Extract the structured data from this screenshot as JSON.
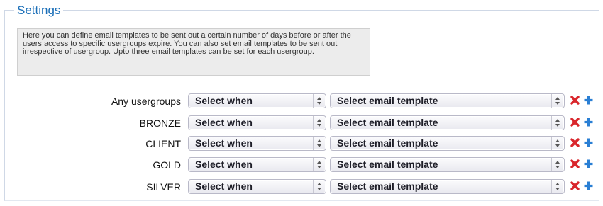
{
  "settings": {
    "legend": "Settings",
    "info_text": "Here you can define email templates to be sent out a certain number of days before or after the users access to specific usergroups expire. You can also set email templates to be sent out irrespective of usergroup. Upto three email templates can be set for each usergroup."
  },
  "rows": [
    {
      "label": "Any usergroups",
      "when": "Select when",
      "template": "Select email template"
    },
    {
      "label": "BRONZE",
      "when": "Select when",
      "template": "Select email template"
    },
    {
      "label": "CLIENT",
      "when": "Select when",
      "template": "Select email template"
    },
    {
      "label": "GOLD",
      "when": "Select when",
      "template": "Select email template"
    },
    {
      "label": "SILVER",
      "when": "Select when",
      "template": "Select email template"
    }
  ],
  "icons": {
    "delete": "delete-icon",
    "add": "add-icon"
  },
  "colors": {
    "legend": "#1b6fb8",
    "delete": "#d9262c",
    "add": "#2a7fd4"
  }
}
